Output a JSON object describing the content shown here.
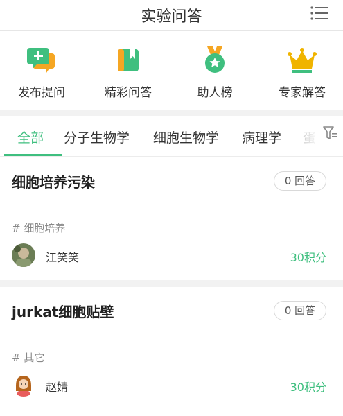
{
  "header": {
    "title": "实验问答",
    "menu_icon": "list-menu-icon"
  },
  "quick_actions": [
    {
      "label": "发布提问",
      "icon": "ask-question-icon",
      "color": "#3fbf7f"
    },
    {
      "label": "精彩问答",
      "icon": "book-icon",
      "color": "#3fbf7f"
    },
    {
      "label": "助人榜",
      "icon": "medal-icon",
      "color": "#3fbf7f"
    },
    {
      "label": "专家解答",
      "icon": "crown-icon",
      "color": "#3fbf7f"
    }
  ],
  "tabs": [
    {
      "label": "全部",
      "active": true
    },
    {
      "label": "分子生物学",
      "active": false
    },
    {
      "label": "细胞生物学",
      "active": false
    },
    {
      "label": "病理学",
      "active": false
    },
    {
      "label": "蛋",
      "active": false
    }
  ],
  "filter_icon": "filter-icon",
  "questions": [
    {
      "title": "细胞培养污染",
      "answers": "0 回答",
      "tag": "# 细胞培养",
      "user": "江笑笑",
      "points": "30积分"
    },
    {
      "title": "jurkat细胞贴壁",
      "answers": "0 回答",
      "tag": "# 其它",
      "user": "赵婧",
      "points": "30积分"
    }
  ],
  "colors": {
    "accent": "#3fbf7f",
    "orange": "#f5a623",
    "gold": "#f0b400",
    "background_gap": "#f2f2f2"
  }
}
